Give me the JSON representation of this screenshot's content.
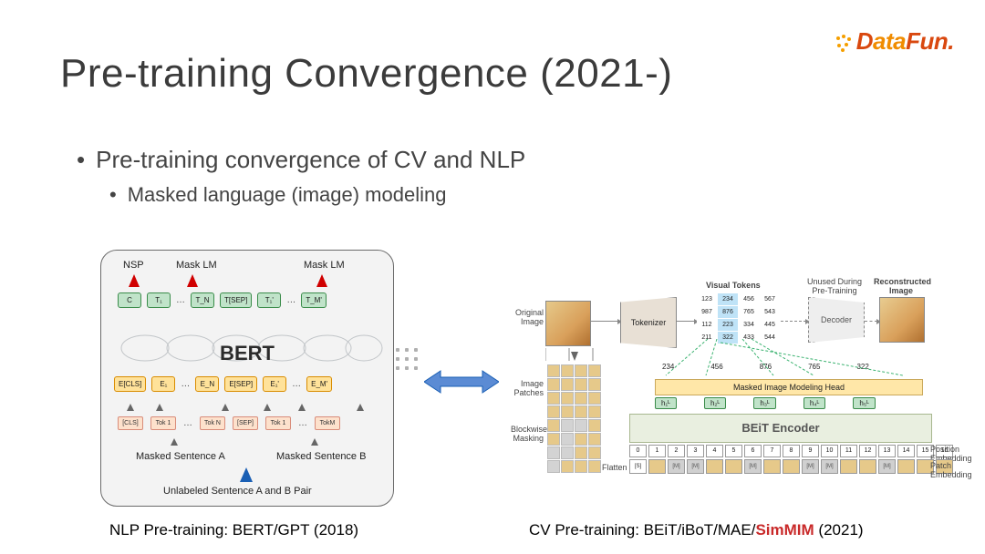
{
  "logo": {
    "text_prefix": "D",
    "text_mid": "ata",
    "text_suffix": "Fun."
  },
  "title": "Pre-training Convergence (2021-)",
  "bullets": {
    "b1": "Pre-training convergence of CV and NLP",
    "b2": "Masked language (image) modeling"
  },
  "bert": {
    "nsp": "NSP",
    "masklm": "Mask LM",
    "big": "BERT",
    "top_tokens": [
      "C",
      "T₁",
      "…",
      "T_N",
      "T[SEP]",
      "T₁'",
      "…",
      "T_M'"
    ],
    "emb_tokens": [
      "E[CLS]",
      "E₁",
      "…",
      "E_N",
      "E[SEP]",
      "E₁'",
      "…",
      "E_M'"
    ],
    "pale_tokens": [
      "[CLS]",
      "Tok 1",
      "…",
      "Tok N",
      "[SEP]",
      "Tok 1",
      "…",
      "TokM"
    ],
    "masked_a": "Masked Sentence A",
    "masked_b": "Masked Sentence B",
    "unlabeled": "Unlabeled Sentence A and B Pair"
  },
  "beit": {
    "original": "Original Image",
    "tokenizer": "Tokenizer",
    "visual_tokens_title": "Visual Tokens",
    "vt": [
      "123",
      "234",
      "456",
      "567",
      "987",
      "876",
      "765",
      "543",
      "112",
      "223",
      "334",
      "445",
      "211",
      "322",
      "433",
      "544"
    ],
    "vt_hl": [
      1,
      5,
      9,
      13
    ],
    "unused": "Unused During Pre-Training",
    "decoder": "Decoder",
    "recon": "Reconstructed Image",
    "image_patches": "Image Patches",
    "blockwise": "Blockwise Masking",
    "flatten": "Flatten",
    "mim_head": "Masked Image Modeling Head",
    "encoder": "BEiT Encoder",
    "pos_label": "Position Embedding",
    "patch_label": "Patch Embedding",
    "example_tokens_top": [
      "234",
      "456",
      "876",
      "765",
      "322"
    ],
    "hstates": [
      "h₁ᴸ",
      "h₂ᴸ",
      "h₃ᴸ",
      "h₄ᴸ",
      "h₅ᴸ"
    ],
    "positions": [
      "0",
      "1",
      "2",
      "3",
      "4",
      "5",
      "6",
      "7",
      "8",
      "9",
      "10",
      "11",
      "12",
      "13",
      "14",
      "15",
      "16"
    ],
    "patches": [
      "[S]",
      "",
      "[M]",
      "[M]",
      "",
      "",
      "[M]",
      "",
      "",
      "[M]",
      "[M]",
      "",
      "",
      "[M]",
      "",
      "",
      ""
    ]
  },
  "captions": {
    "left": "NLP Pre-training: BERT/GPT (2018)",
    "right_prefix": "CV Pre-training: BEiT/iBoT/MAE/",
    "right_highlight": "SimMIM",
    "right_suffix": " (2021)"
  }
}
